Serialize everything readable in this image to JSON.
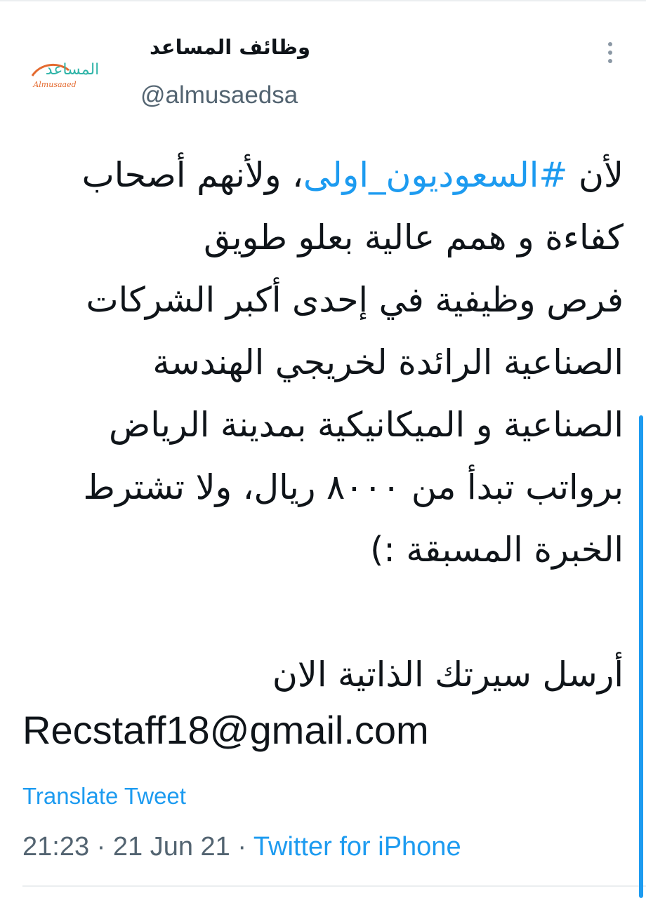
{
  "user": {
    "display_name": "وظائف المساعد",
    "handle": "@almusaedsa",
    "avatar_logo_text": "المساعد",
    "avatar_logo_subtext": "Almusaaed"
  },
  "tweet": {
    "line1_before": "لأن ",
    "line1_hashtag": "#السعوديون_اولى",
    "line1_after": "، ولأنهم أصحاب",
    "line2": "كفاءة و همم عالية بعلو طويق",
    "line3": "فرص وظيفية في إحدى أكبر الشركات",
    "line4": "الصناعية الرائدة لخريجي الهندسة",
    "line5": "الصناعية و الميكانيكية بمدينة الرياض",
    "line6": "برواتب تبدأ من ٨٠٠٠ ريال، ولا تشترط",
    "line7": "الخبرة المسبقة :)",
    "line8": "أرسل سيرتك الذاتية الان",
    "email": "Recstaff18@gmail.com"
  },
  "translate_label": "Translate Tweet",
  "meta": {
    "time": "21:23",
    "sep1": " · ",
    "date": "21 Jun 21",
    "sep2": " · ",
    "source": "Twitter for iPhone"
  },
  "colors": {
    "link": "#1d9bf0",
    "secondary_text": "#536471",
    "primary_text": "#0f1419",
    "logo_teal": "#2fb4a8",
    "logo_orange": "#e46a2f"
  },
  "icons": {
    "more": "vertical-ellipsis"
  }
}
